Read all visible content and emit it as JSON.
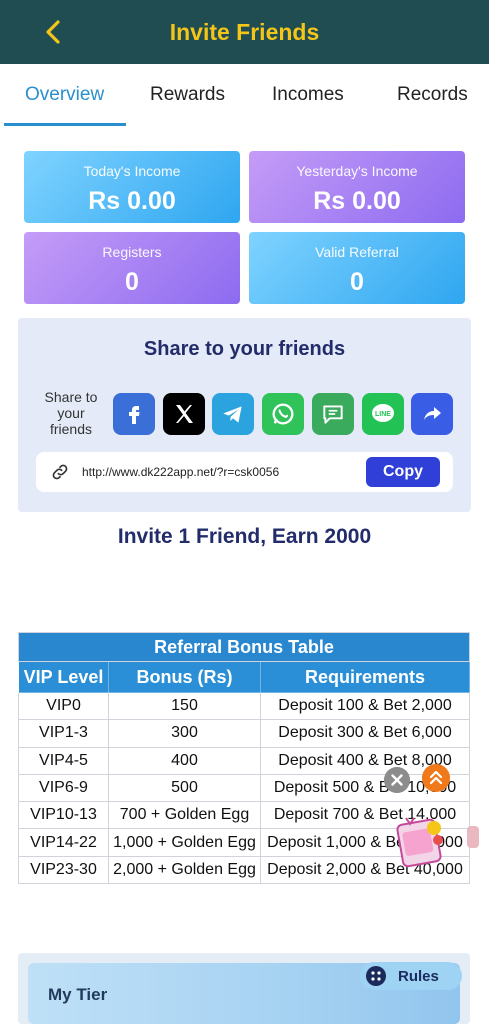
{
  "header": {
    "title": "Invite Friends"
  },
  "tabs": [
    {
      "label": "Overview"
    },
    {
      "label": "Rewards"
    },
    {
      "label": "Incomes"
    },
    {
      "label": "Records"
    }
  ],
  "stats": {
    "today_income_label": "Today's Income",
    "today_income_value": "Rs 0.00",
    "yesterday_income_label": "Yesterday's Income",
    "yesterday_income_value": "Rs 0.00",
    "registers_label": "Registers",
    "registers_value": "0",
    "valid_referral_label": "Valid Referral",
    "valid_referral_value": "0"
  },
  "share": {
    "title": "Share to your friends",
    "label": "Share to your friends",
    "icons": [
      "facebook-icon",
      "x-icon",
      "telegram-icon",
      "whatsapp-icon",
      "sms-icon",
      "line-icon",
      "share-arrow-icon"
    ],
    "link": "http://www.dk222app.net/?r=csk0056",
    "copy_label": "Copy"
  },
  "invite_text": "Invite 1 Friend, Earn 2000",
  "referral_table": {
    "title": "Referral Bonus Table",
    "headers": [
      "VIP Level",
      "Bonus (Rs)",
      "Requirements"
    ],
    "rows": [
      [
        "VIP0",
        "150",
        "Deposit 100 & Bet 2,000"
      ],
      [
        "VIP1-3",
        "300",
        "Deposit 300 & Bet 6,000"
      ],
      [
        "VIP4-5",
        "400",
        "Deposit 400 & Bet 8,000"
      ],
      [
        "VIP6-9",
        "500",
        "Deposit 500 & Bet 10,000"
      ],
      [
        "VIP10-13",
        "700 + Golden Egg",
        "Deposit 700 & Bet 14,000"
      ],
      [
        "VIP14-22",
        "1,000 + Golden Egg",
        "Deposit 1,000 & Bet 20,000"
      ],
      [
        "VIP23-30",
        "2,000 + Golden Egg",
        "Deposit 2,000 & Bet 40,000"
      ]
    ]
  },
  "tier": {
    "title": "My Tier",
    "rules_label": "Rules"
  },
  "colors": {
    "header_bg": "#1f4d52",
    "accent": "#f5c518",
    "tab_active": "#2a8fcf",
    "copy_button": "#2f3fd8"
  }
}
